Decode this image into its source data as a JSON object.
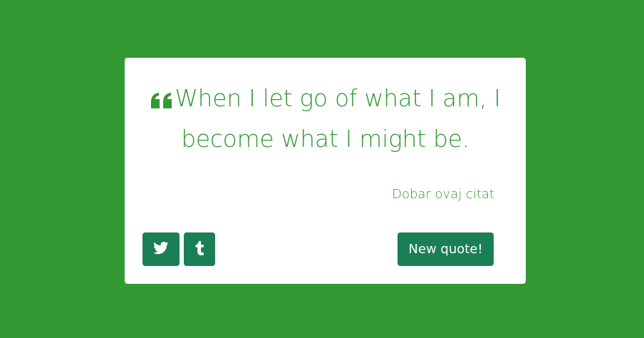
{
  "quote": {
    "text": "When I let go of what I am, I become what I might be.",
    "author": "Dobar ovaj citat"
  },
  "buttons": {
    "new_quote_label": "New quote!"
  },
  "icons": {
    "quote": "quote-left-icon",
    "twitter": "twitter-icon",
    "tumblr": "tumblr-icon"
  },
  "colors": {
    "background": "#339933",
    "card": "#ffffff",
    "accent": "#339933",
    "button": "#1a7f55"
  }
}
